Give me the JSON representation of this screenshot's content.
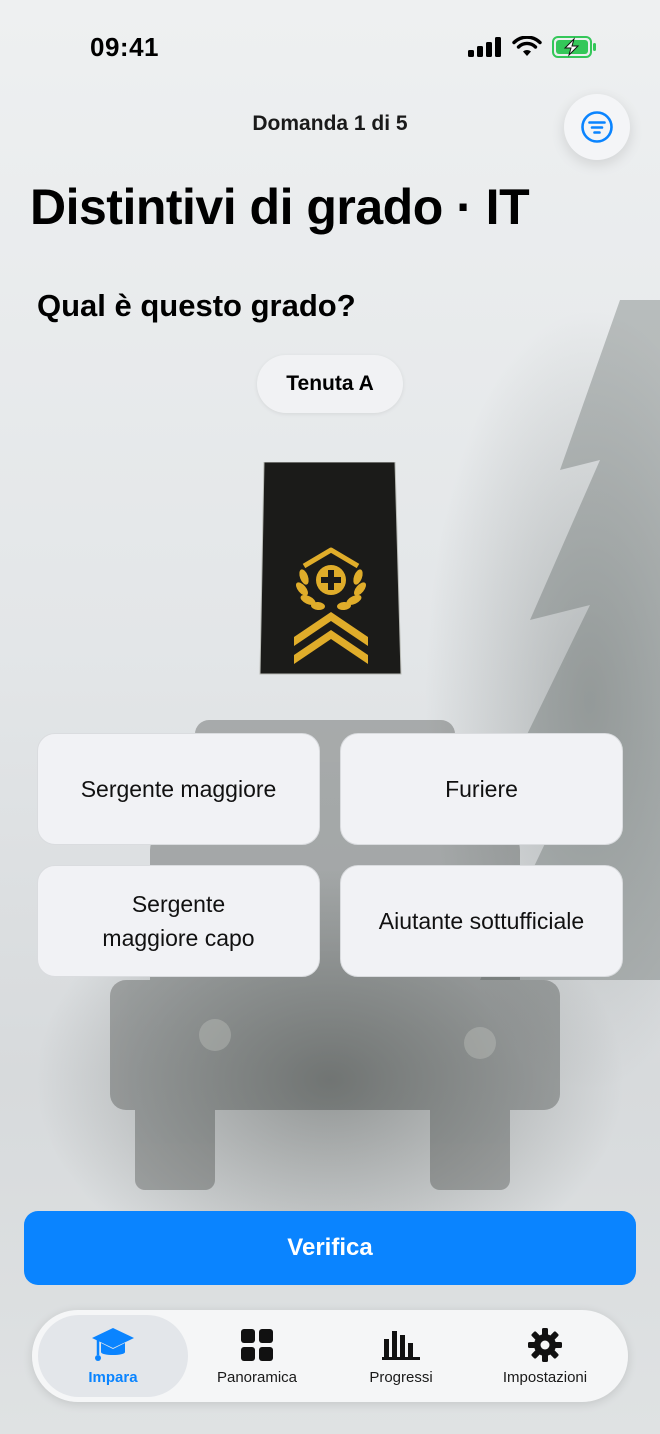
{
  "status": {
    "time": "09:41"
  },
  "header": {
    "question_counter": "Domanda 1 di 5"
  },
  "page": {
    "title": "Distintivi di grado · IT",
    "question": "Qual è questo grado?",
    "outfit_label": "Tenuta A"
  },
  "answers": [
    {
      "label": "Sergente maggiore"
    },
    {
      "label": "Furiere"
    },
    {
      "label": "Sergente maggiore capo"
    },
    {
      "label": "Aiutante sottufficiale"
    }
  ],
  "actions": {
    "verify_label": "Verifica"
  },
  "tabs": [
    {
      "label": "Impara",
      "icon": "graduation-cap-icon",
      "active": true
    },
    {
      "label": "Panoramica",
      "icon": "grid-icon",
      "active": false
    },
    {
      "label": "Progressi",
      "icon": "bar-chart-icon",
      "active": false
    },
    {
      "label": "Impostazioni",
      "icon": "gear-icon",
      "active": false
    }
  ],
  "colors": {
    "accent": "#0a84ff",
    "badge_gold": "#e0ad2a",
    "badge_background": "#1b1b19"
  }
}
